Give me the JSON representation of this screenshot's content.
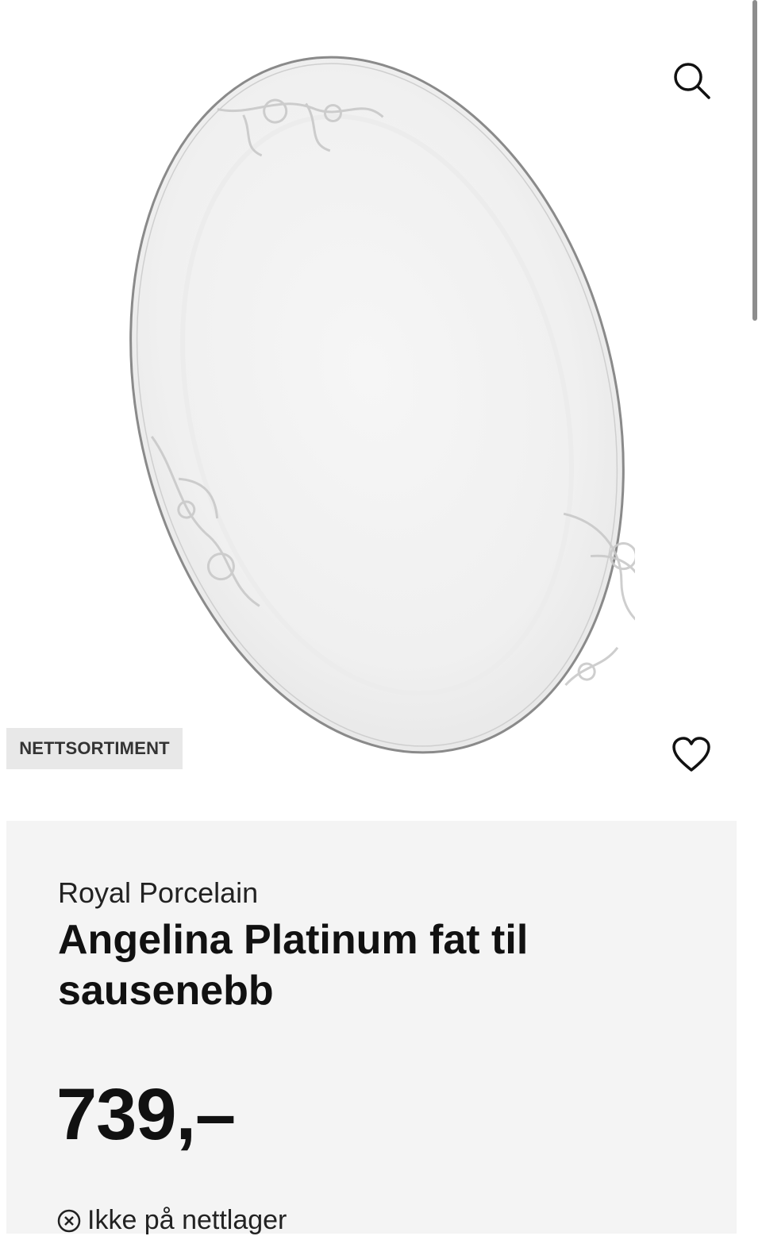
{
  "product": {
    "badge": "NETTSORTIMENT",
    "brand": "Royal Porcelain",
    "title": "Angelina Platinum fat til sausenebb",
    "price": "739,–",
    "stock_status": "Ikke på nettlager"
  },
  "icons": {
    "search": "search-icon",
    "favorite": "heart-icon",
    "stock": "x-circle-icon"
  },
  "colors": {
    "panel_background": "#f4f4f4",
    "badge_background": "#e8e8e8",
    "text": "#111111"
  }
}
